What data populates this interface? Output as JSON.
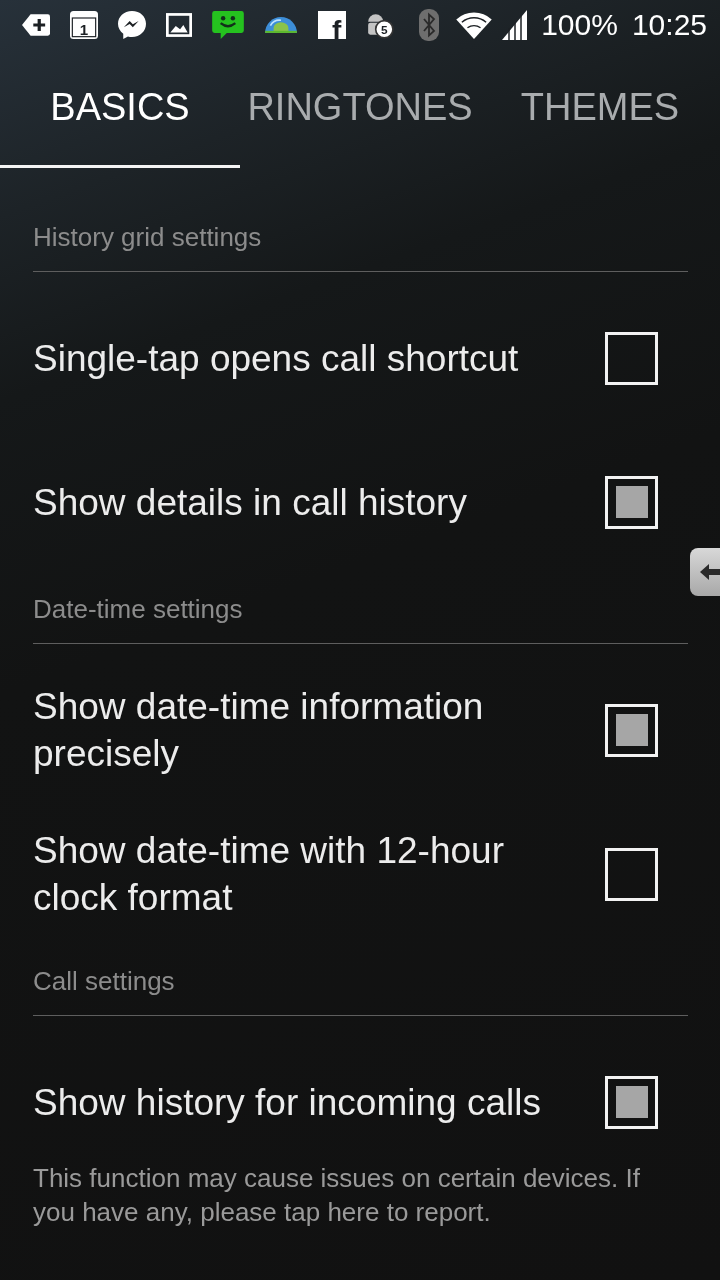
{
  "status_bar": {
    "notification_icons": [
      {
        "kind": "tag"
      },
      {
        "kind": "calendar",
        "badge": "1"
      },
      {
        "kind": "bubble"
      },
      {
        "kind": "image"
      },
      {
        "kind": "chat"
      },
      {
        "kind": "globe"
      },
      {
        "kind": "letter",
        "badge": "f"
      },
      {
        "kind": "android",
        "badge": "5"
      }
    ],
    "battery": "100%",
    "time": "10:25"
  },
  "tabs": [
    {
      "label": "BASICS",
      "selected": true
    },
    {
      "label": "RINGTONES",
      "selected": false
    },
    {
      "label": "THEMES",
      "selected": false
    }
  ],
  "sections": [
    {
      "title": "History grid settings",
      "items": [
        {
          "label": "Single-tap opens call shortcut",
          "checked": false
        },
        {
          "label": "Show details in call history",
          "checked": true
        }
      ]
    },
    {
      "title": "Date-time settings",
      "items": [
        {
          "label": "Show date-time information precisely",
          "checked": true
        },
        {
          "label": "Show date-time with 12-hour clock format",
          "checked": false
        }
      ]
    },
    {
      "title": "Call settings",
      "items": [
        {
          "label": "Show history for incoming calls",
          "checked": true
        }
      ]
    }
  ],
  "note": "This function may cause issues on certain devices. If you have any, please tap here to report."
}
